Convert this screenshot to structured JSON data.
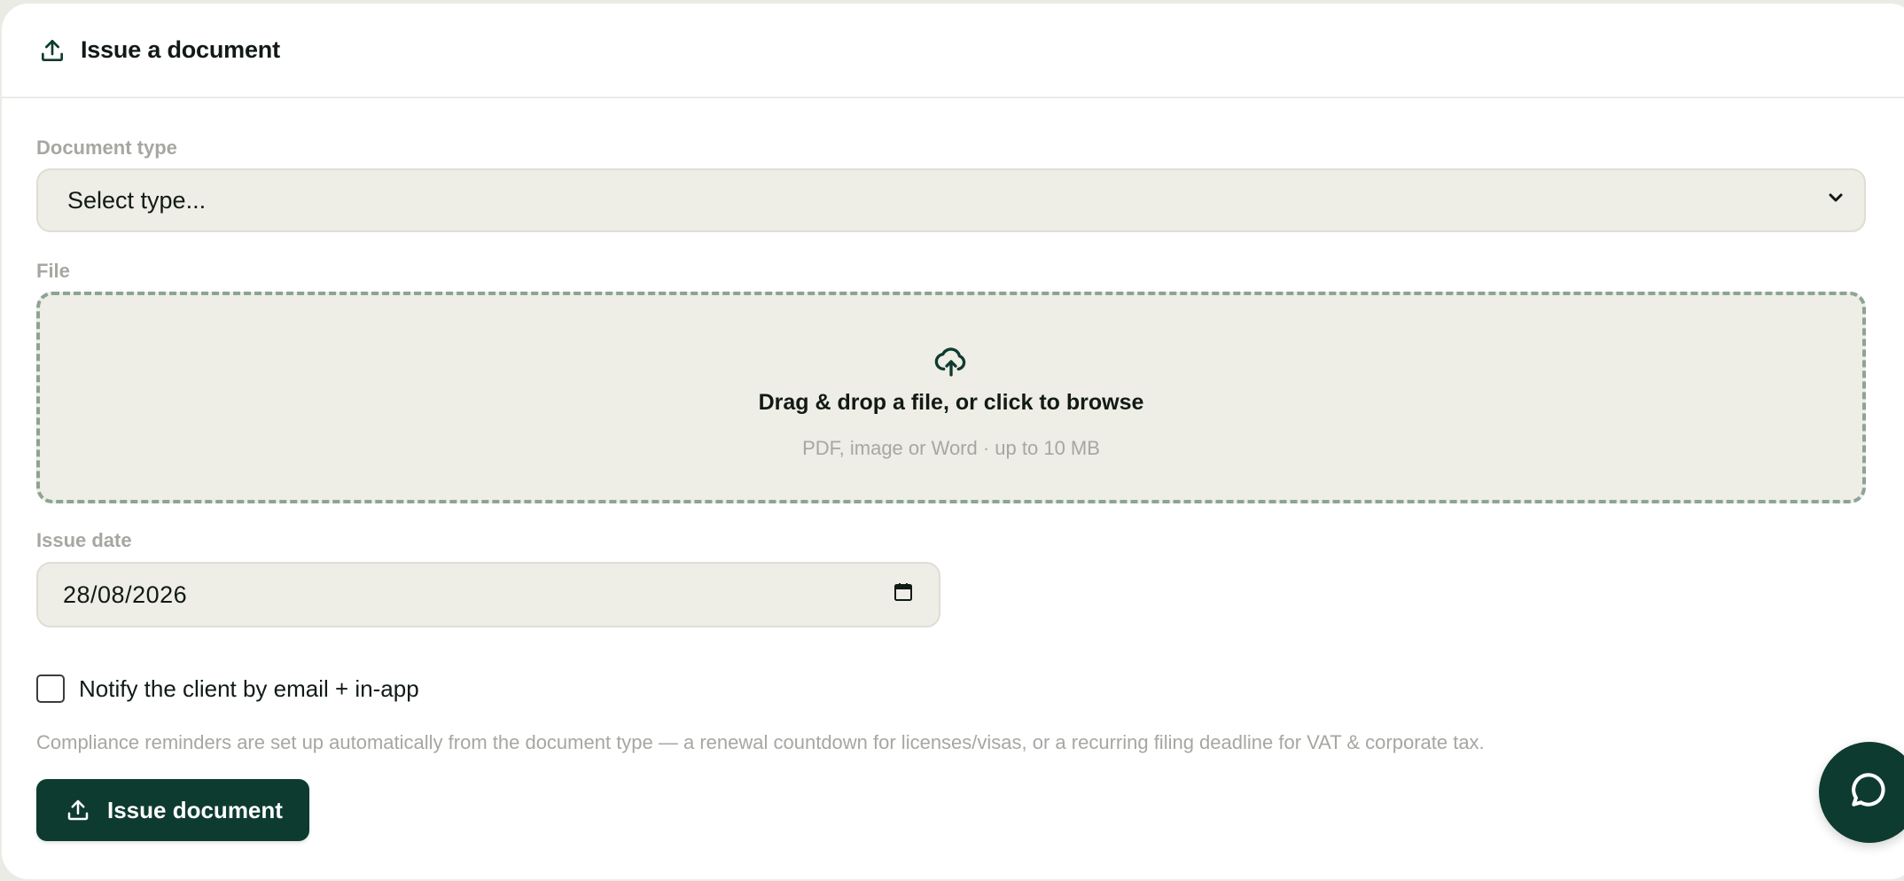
{
  "header": {
    "title": "Issue a document",
    "icon": "upload-icon"
  },
  "form": {
    "document_type": {
      "label": "Document type",
      "value": "Select type..."
    },
    "file": {
      "label": "File",
      "dropzone_title": "Drag & drop a file, or click to browse",
      "dropzone_hint": "PDF, image or Word · up to 10 MB",
      "icon": "cloud-upload-icon"
    },
    "issue_date": {
      "label": "Issue date",
      "value": "28/08/2026"
    },
    "notify": {
      "label": "Notify the client by email + in-app",
      "checked": false
    },
    "note": "Compliance reminders are set up automatically from the document type — a renewal countdown for licenses/visas, or a recurring filing deadline for VAT & corporate tax.",
    "submit": {
      "label": "Issue document"
    }
  },
  "colors": {
    "primary": "#0e3b2f",
    "field_bg": "#eeede6",
    "dashed_border": "#8da395",
    "muted_text": "#a5a8a1"
  }
}
